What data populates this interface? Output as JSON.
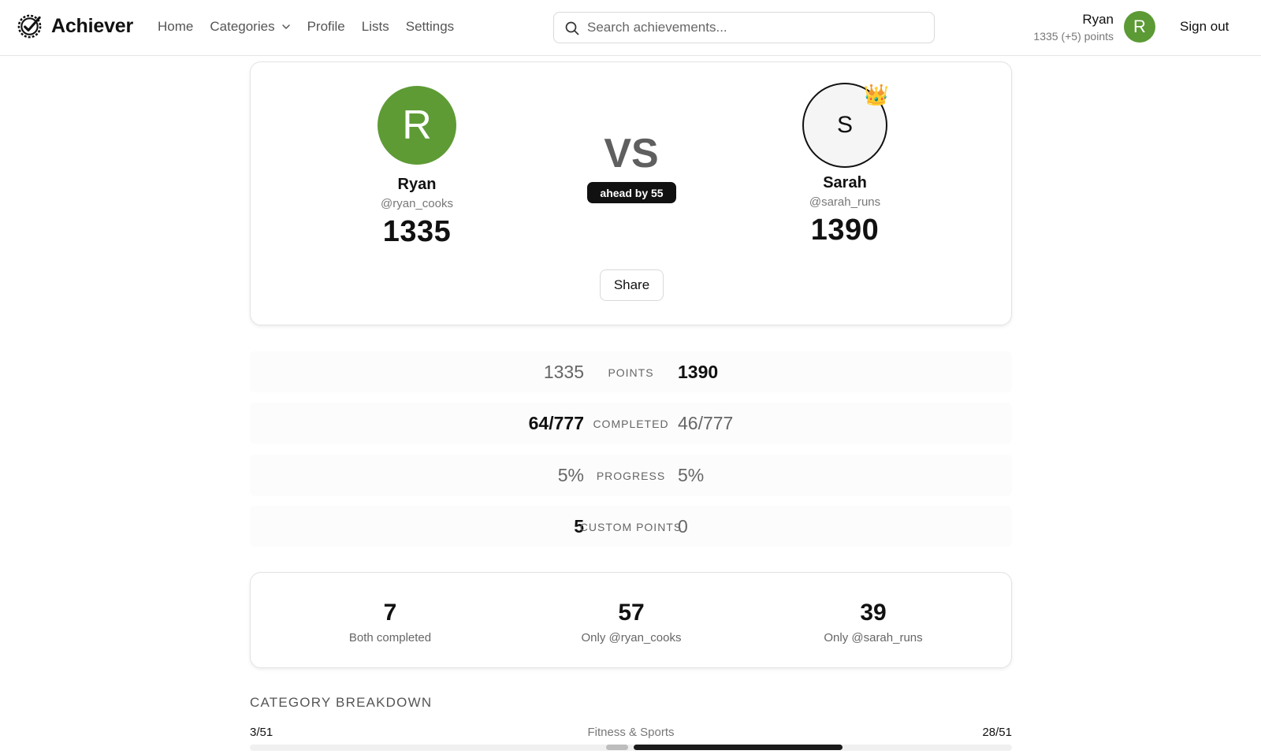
{
  "header": {
    "brand": "Achiever",
    "nav": [
      "Home",
      "Categories",
      "Profile",
      "Lists",
      "Settings"
    ],
    "search_placeholder": "Search achievements...",
    "user": {
      "name": "Ryan",
      "points": "1335 (+5) points",
      "initial": "R"
    },
    "sign_out": "Sign out"
  },
  "comparison": {
    "left": {
      "initial": "R",
      "name": "Ryan",
      "handle": "@ryan_cooks",
      "score": "1335"
    },
    "right": {
      "initial": "S",
      "name": "Sarah",
      "handle": "@sarah_runs",
      "score": "1390",
      "crown": "👑"
    },
    "vs_label": "VS",
    "ahead_badge": "ahead by 55",
    "share_label": "Share"
  },
  "stats": [
    {
      "label": "POINTS",
      "left": "1335",
      "right": "1390",
      "left_state": "lose",
      "right_state": "win"
    },
    {
      "label": "COMPLETED",
      "left": "64/777",
      "right": "46/777",
      "left_state": "win",
      "right_state": "lose"
    },
    {
      "label": "PROGRESS",
      "left": "5%",
      "right": "5%",
      "left_state": "tie",
      "right_state": "tie"
    },
    {
      "label": "CUSTOM POINTS",
      "left": "5",
      "right": "0",
      "left_state": "win",
      "right_state": "lose"
    }
  ],
  "overlap": [
    {
      "value": "7",
      "label": "Both completed"
    },
    {
      "value": "57",
      "label": "Only @ryan_cooks"
    },
    {
      "value": "39",
      "label": "Only @sarah_runs"
    }
  ],
  "category_breakdown": {
    "heading": "CATEGORY BREAKDOWN",
    "rows": [
      {
        "name": "Fitness & Sports",
        "left": "3/51",
        "right": "28/51",
        "left_fraction": 0.0588,
        "right_fraction": 0.549
      }
    ]
  },
  "colors": {
    "avatar_green": "#5e9b35",
    "badge_black": "#111111"
  }
}
